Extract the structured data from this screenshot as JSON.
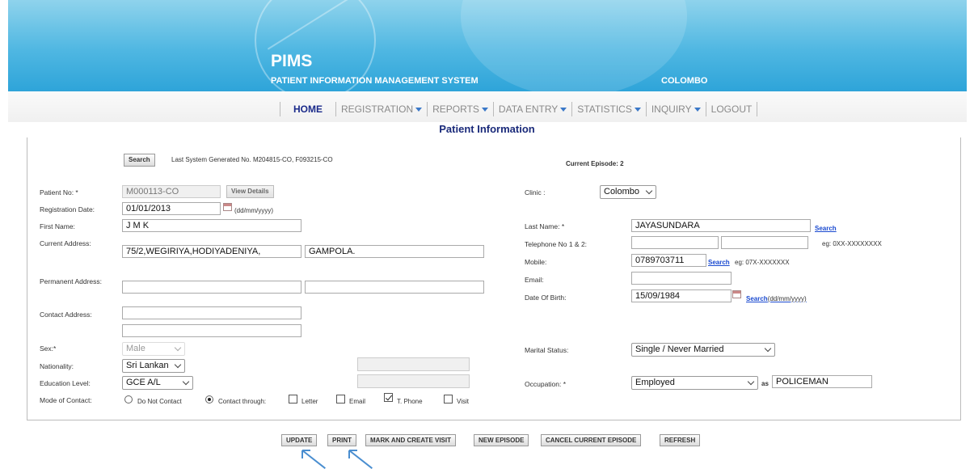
{
  "header": {
    "app_name": "PIMS",
    "subtitle": "PATIENT INFORMATION MANAGEMENT SYSTEM",
    "location": "COLOMBO"
  },
  "nav": {
    "home": "HOME",
    "registration": "REGISTRATION",
    "reports": "REPORTS",
    "data_entry": "DATA ENTRY",
    "statistics": "STATISTICS",
    "inquiry": "INQUIRY",
    "logout": "LOGOUT"
  },
  "page_title": "Patient Information",
  "search": {
    "button": "Search",
    "last_generated": "Last System Generated No. M204815-CO, F093215-CO",
    "current_episode": "Current Episode: 2"
  },
  "labels": {
    "patient_no": "Patient No: *",
    "registration_date": "Registration Date:",
    "first_name": "First Name:",
    "current_address": "Current Address:",
    "permanent_address": "Permanent Address:",
    "contact_address": "Contact Address:",
    "sex": "Sex:*",
    "nationality": "Nationality:",
    "education_level": "Education Level:",
    "mode_of_contact": "Mode of Contact:",
    "clinic": "Clinic :",
    "last_name": "Last Name: *",
    "telephone": "Telephone No 1 & 2:",
    "mobile": "Mobile:",
    "email": "Email:",
    "dob": "Date Of Birth:",
    "marital_status": "Marital Status:",
    "occupation": "Occupation: *"
  },
  "values": {
    "patient_no": "M000113-CO",
    "registration_date": "01/01/2013",
    "date_hint": "(dd/mm/yyyy)",
    "first_name": "J M K",
    "current_address_1": "75/2,WEGIRIYA,HODIYADENIYA,",
    "current_address_2": "GAMPOLA.",
    "permanent_address_1": "",
    "permanent_address_2": "",
    "contact_address_1": "",
    "contact_address_2": "",
    "sex": "Male",
    "nationality": "Sri Lankan",
    "education_level": "GCE A/L",
    "clinic": "Colombo",
    "last_name": "JAYASUNDARA",
    "telephone_1": "",
    "telephone_2": "",
    "telephone_hint": "eg: 0XX-XXXXXXXX",
    "mobile": "0789703711",
    "mobile_hint": "eg: 07X-XXXXXXX",
    "email": "",
    "dob": "15/09/1984",
    "dob_hint": "(dd/mm/yyyy)",
    "marital_status": "Single / Never Married",
    "occupation": "Employed",
    "occupation_as": "as",
    "occupation_detail": "POLICEMAN"
  },
  "buttons": {
    "view_details": "View Details",
    "search": "Search",
    "update": "UPDATE",
    "print": "PRINT",
    "mark_visit": "MARK AND CREATE VISIT",
    "new_episode": "NEW EPISODE",
    "cancel_episode": "CANCEL CURRENT EPISODE",
    "refresh": "REFRESH"
  },
  "contact_modes": {
    "do_not_contact": "Do Not Contact",
    "contact_through": "Contact through:",
    "letter": "Letter",
    "email": "Email",
    "t_phone": "T. Phone",
    "visit": "Visit",
    "selected": "Contact through:",
    "checked": [
      "T. Phone"
    ]
  }
}
